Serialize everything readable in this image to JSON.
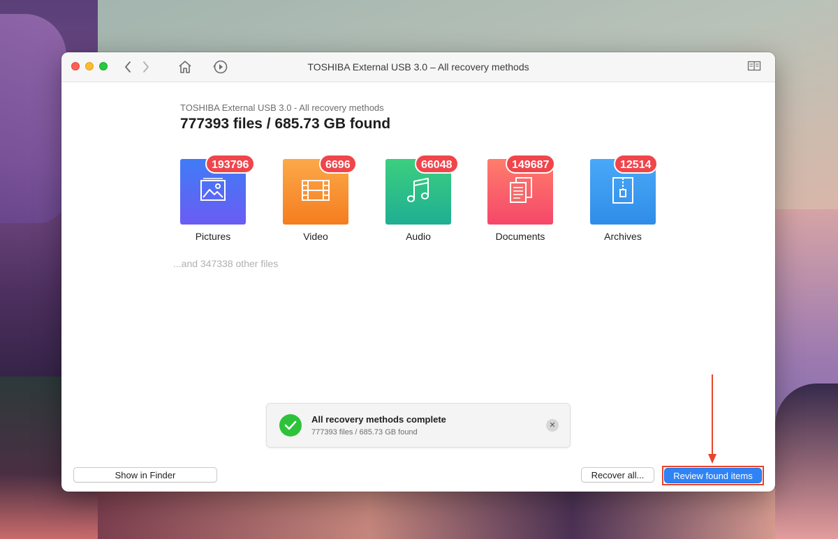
{
  "window": {
    "title": "TOSHIBA External USB 3.0 – All recovery methods"
  },
  "summary": {
    "subtitle": "TOSHIBA External USB 3.0 - All recovery methods",
    "headline": "777393 files / 685.73 GB found",
    "others": "...and 347338 other files"
  },
  "categories": [
    {
      "label": "Pictures",
      "count": "193796",
      "icon": "image-icon",
      "color_top": "#3f7cf6",
      "color_bottom": "#6b5cf3"
    },
    {
      "label": "Video",
      "count": "6696",
      "icon": "film-icon",
      "color_top": "#fba94a",
      "color_bottom": "#f57d1f"
    },
    {
      "label": "Audio",
      "count": "66048",
      "icon": "music-note-icon",
      "color_top": "#3ccf7f",
      "color_bottom": "#1fae93"
    },
    {
      "label": "Documents",
      "count": "149687",
      "icon": "document-icon",
      "color_top": "#ff7d6b",
      "color_bottom": "#f5476a"
    },
    {
      "label": "Archives",
      "count": "12514",
      "icon": "archive-icon",
      "color_top": "#4aa8f8",
      "color_bottom": "#2f8de8"
    }
  ],
  "toast": {
    "title": "All recovery methods complete",
    "subtitle": "777393 files / 685.73 GB found"
  },
  "buttons": {
    "show_in_finder": "Show in Finder",
    "recover_all": "Recover all...",
    "review_found_items": "Review found items"
  },
  "colors": {
    "badge": "#f0454b",
    "primary": "#2f83f5",
    "annotation": "#e8432c"
  }
}
